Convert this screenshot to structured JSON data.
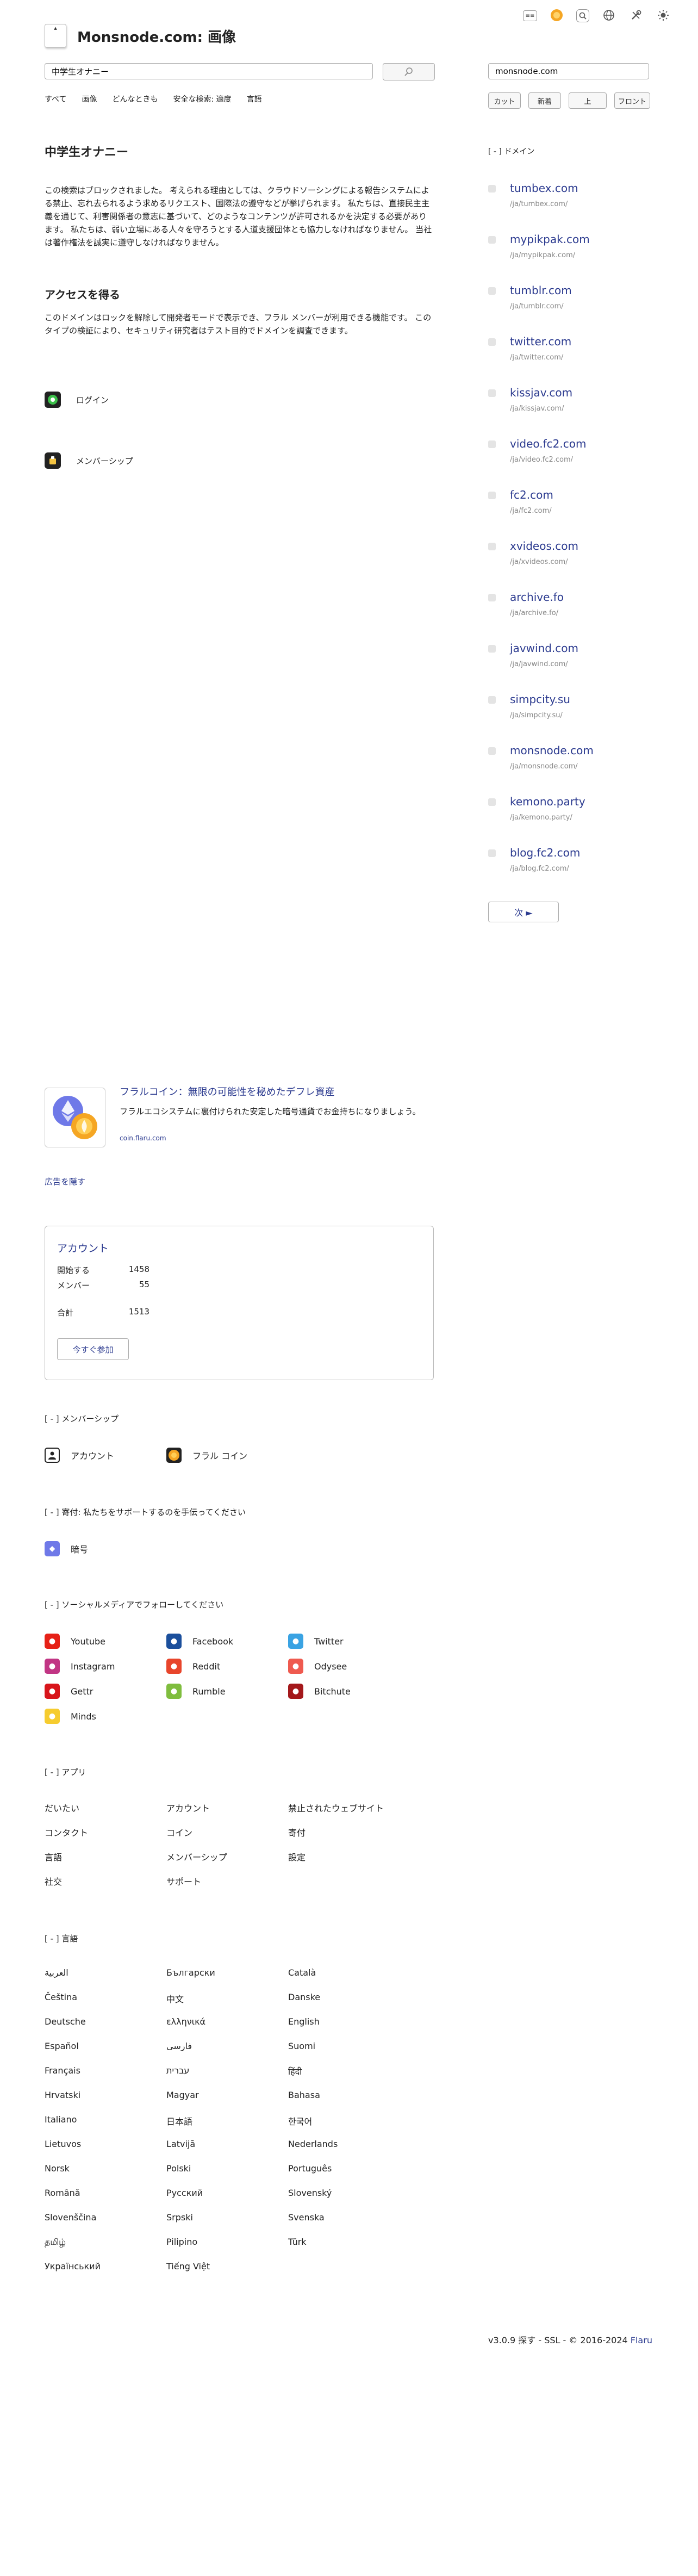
{
  "top_icons": [
    "search-engine-icon",
    "flaru-coin-icon",
    "search-settings-icon",
    "globe-icon",
    "tools-icon",
    "sun-icon"
  ],
  "header": {
    "site_title": "Monsnode.com: 画像",
    "search_value": "中学生オナニー",
    "tabs": [
      "すべて",
      "画像",
      "どんなときも",
      "安全な検索: 適度",
      "言語"
    ]
  },
  "sidebar_search": {
    "value": "monsnode.com",
    "buttons": [
      "カット",
      "新着",
      "上",
      "フロント"
    ]
  },
  "main": {
    "heading": "中学生オナニー",
    "blocked_text": "この検索はブロックされました。 考えられる理由としては、クラウドソーシングによる報告システムによる禁止、忘れ去られるよう求めるリクエスト、国際法の遵守などが挙げられます。 私たちは、直接民主主義を通じて、利害関係者の意志に基づいて、どのようなコンテンツが許可されるかを決定する必要があります。 私たちは、弱い立場にある人々を守ろうとする人道支援団体とも協力しなければなりません。 当社は著作権法を誠実に遵守しなければなりません。",
    "access_heading": "アクセスを得る",
    "access_text": "このドメインはロックを解除して開発者モードで表示でき、フラル メンバーが利用できる機能です。 このタイプの検証により、セキュリティ研究者はテスト目的でドメインを調査できます。",
    "login_label": "ログイン",
    "membership_label": "メンバーシップ"
  },
  "domains": {
    "header": "[ - ] ドメイン",
    "items": [
      {
        "title": "tumbex.com",
        "url": "/ja/tumbex.com/"
      },
      {
        "title": "mypikpak.com",
        "url": "/ja/mypikpak.com/"
      },
      {
        "title": "tumblr.com",
        "url": "/ja/tumblr.com/"
      },
      {
        "title": "twitter.com",
        "url": "/ja/twitter.com/"
      },
      {
        "title": "kissjav.com",
        "url": "/ja/kissjav.com/"
      },
      {
        "title": "video.fc2.com",
        "url": "/ja/video.fc2.com/"
      },
      {
        "title": "fc2.com",
        "url": "/ja/fc2.com/"
      },
      {
        "title": "xvideos.com",
        "url": "/ja/xvideos.com/"
      },
      {
        "title": "archive.fo",
        "url": "/ja/archive.fo/"
      },
      {
        "title": "javwind.com",
        "url": "/ja/javwind.com/"
      },
      {
        "title": "simpcity.su",
        "url": "/ja/simpcity.su/"
      },
      {
        "title": "monsnode.com",
        "url": "/ja/monsnode.com/"
      },
      {
        "title": "kemono.party",
        "url": "/ja/kemono.party/"
      },
      {
        "title": "blog.fc2.com",
        "url": "/ja/blog.fc2.com/"
      }
    ],
    "next_label": "次 ►"
  },
  "ad": {
    "title": "フラルコイン：無限の可能性を秘めたデフレ資産",
    "description": "フラルエコシステムに裏付けられた安定した暗号通貨でお金持ちになりましょう。",
    "url": "coin.flaru.com",
    "hide_label": "広告を隠す"
  },
  "account_box": {
    "title": "アカウント",
    "rows": [
      {
        "label": "開始する",
        "value": "1458"
      },
      {
        "label": "メンバー",
        "value": "55"
      },
      {
        "label": "合計",
        "value": "1513"
      }
    ],
    "join_label": "今すぐ参加"
  },
  "membership_section": {
    "header": "[ - ] メンバーシップ",
    "items": [
      "アカウント",
      "フラル コイン"
    ]
  },
  "donation_section": {
    "header": "[ - ] 寄付: 私たちをサポートするのを手伝ってください",
    "items": [
      "暗号"
    ]
  },
  "social_section": {
    "header": "[ - ] ソーシャルメディアでフォローしてください",
    "items": [
      {
        "label": "Youtube",
        "icon": "youtube-icon",
        "color": "#e62117"
      },
      {
        "label": "Facebook",
        "icon": "facebook-icon",
        "color": "#1b4f9c"
      },
      {
        "label": "Twitter",
        "icon": "twitter-icon",
        "color": "#3aa3e3"
      },
      {
        "label": "Instagram",
        "icon": "instagram-icon",
        "color": "#c13584"
      },
      {
        "label": "Reddit",
        "icon": "reddit-icon",
        "color": "#e8452b"
      },
      {
        "label": "Odysee",
        "icon": "odysee-icon",
        "color": "#ef5a4f"
      },
      {
        "label": "Gettr",
        "icon": "gettr-icon",
        "color": "#d8151b"
      },
      {
        "label": "Rumble",
        "icon": "rumble-icon",
        "color": "#7fbd3e"
      },
      {
        "label": "Bitchute",
        "icon": "bitchute-icon",
        "color": "#a4181b"
      },
      {
        "label": "Minds",
        "icon": "minds-icon",
        "color": "#f6cc2f"
      }
    ]
  },
  "apps_section": {
    "header": "[ - ] アプリ",
    "columns": [
      [
        "だいたい",
        "コンタクト",
        "言語",
        "社交"
      ],
      [
        "アカウント",
        "コイン",
        "メンバーシップ",
        "サポート"
      ],
      [
        "禁止されたウェブサイト",
        "寄付",
        "設定"
      ]
    ]
  },
  "language_section": {
    "header": "[ - ] 言語",
    "columns": [
      [
        "العربية",
        "Čeština",
        "Deutsche",
        "Español",
        "Français",
        "Hrvatski",
        "Italiano",
        "Lietuvos",
        "Norsk",
        "Română",
        "Slovenščina",
        "தமிழ்",
        "Український"
      ],
      [
        "Български",
        "中文",
        "ελληνικά",
        "فارسی",
        "עברית",
        "Magyar",
        "日本語",
        "Latvijā",
        "Polski",
        "Русский",
        "Srpski",
        "Pilipino",
        "Tiếng Việt"
      ],
      [
        "Català",
        "Danske",
        "English",
        "Suomi",
        "हिंदी",
        "Bahasa",
        "한국어",
        "Nederlands",
        "Português",
        "Slovenský",
        "Svenska",
        "Türk"
      ]
    ]
  },
  "footer": {
    "copyright": "v3.0.9 探す - SSL - © 2016-2024",
    "brand": "Flaru"
  }
}
